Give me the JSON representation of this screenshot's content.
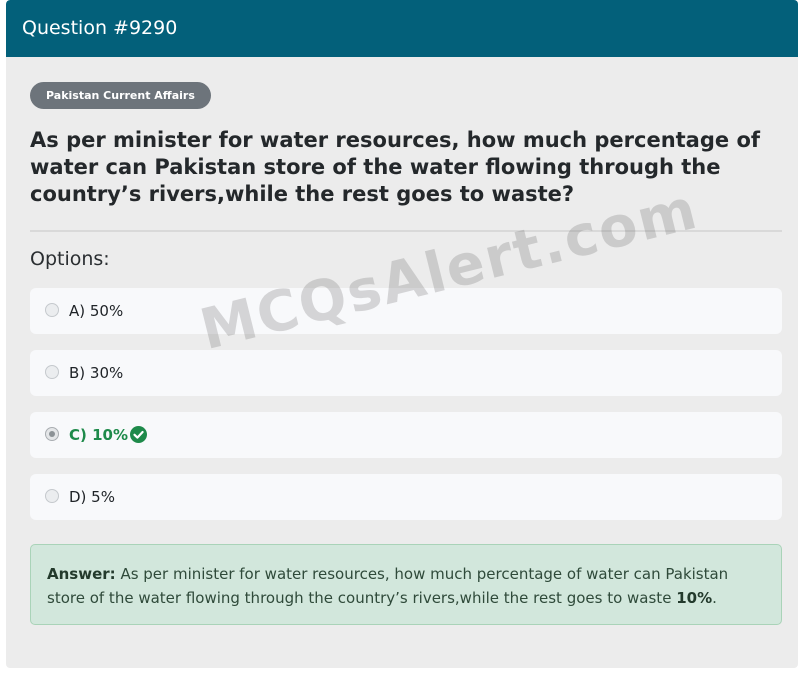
{
  "header": {
    "title": "Question #9290"
  },
  "badge": {
    "label": "Pakistan Current Affairs"
  },
  "question": {
    "text": "As per minister for water resources, how much percentage of water can Pakistan store of the water flowing through the country’s rivers,while the rest goes to waste?"
  },
  "options_label": "Options:",
  "options": [
    {
      "label": "A) 50%",
      "selected": false,
      "correct": false
    },
    {
      "label": "B) 30%",
      "selected": false,
      "correct": false
    },
    {
      "label": "C) 10%",
      "selected": true,
      "correct": true
    },
    {
      "label": "D) 5%",
      "selected": false,
      "correct": false
    }
  ],
  "answer": {
    "prefix": "Answer:",
    "text": "As per minister for water resources, how much percentage of water can Pakistan store of the water flowing through the country’s rivers,while the rest goes to waste",
    "value": "10%",
    "suffix": "."
  },
  "watermark": "MCQsAlert.com",
  "colors": {
    "header_bg": "#03607a",
    "correct": "#1e8a4a",
    "answer_bg": "#d2e7dc"
  }
}
